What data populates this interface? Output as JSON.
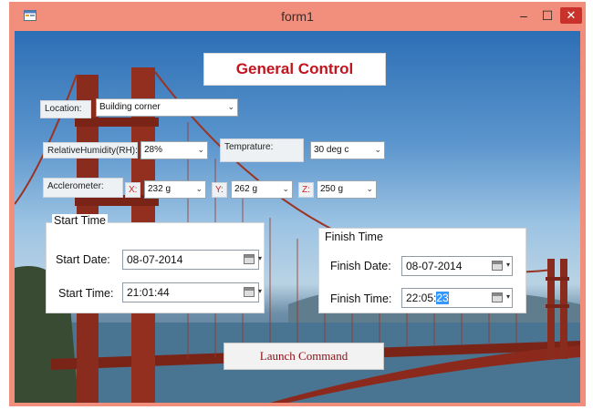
{
  "window": {
    "title": "form1",
    "minimize_glyph": "–",
    "maximize_glyph": "☐",
    "close_glyph": "✕",
    "app_icon": "form-icon"
  },
  "heading": "General Control",
  "location": {
    "label": "Location:",
    "value": "Building corner"
  },
  "humidity": {
    "label": "RelativeHumidity(RH):",
    "value": "28%"
  },
  "temperature": {
    "label": "Temprature:",
    "value": "30 deg c"
  },
  "accelerometer": {
    "label": "Acclerometer:",
    "x_label": "X:",
    "x_value": "232 g",
    "y_label": "Y:",
    "y_value": "262 g",
    "z_label": "Z:",
    "z_value": "250 g"
  },
  "start_time": {
    "group_title": "Start Time",
    "date_label": "Start Date:",
    "date_value": "08-07-2014",
    "time_label": "Start Time:",
    "time_value": "21:01:44"
  },
  "finish_time": {
    "group_title": "Finish Time",
    "date_label": "Finish Date:",
    "date_value": "08-07-2014",
    "time_label": "Finish Time:",
    "time_value_main": "22:05:",
    "time_value_selected": "23"
  },
  "launch_button": "Launch Command",
  "colors": {
    "titlebar": "#f28f7c",
    "heading_text": "#c0141e",
    "axis_label": "#d31f1f",
    "close_button": "#c9322a"
  }
}
